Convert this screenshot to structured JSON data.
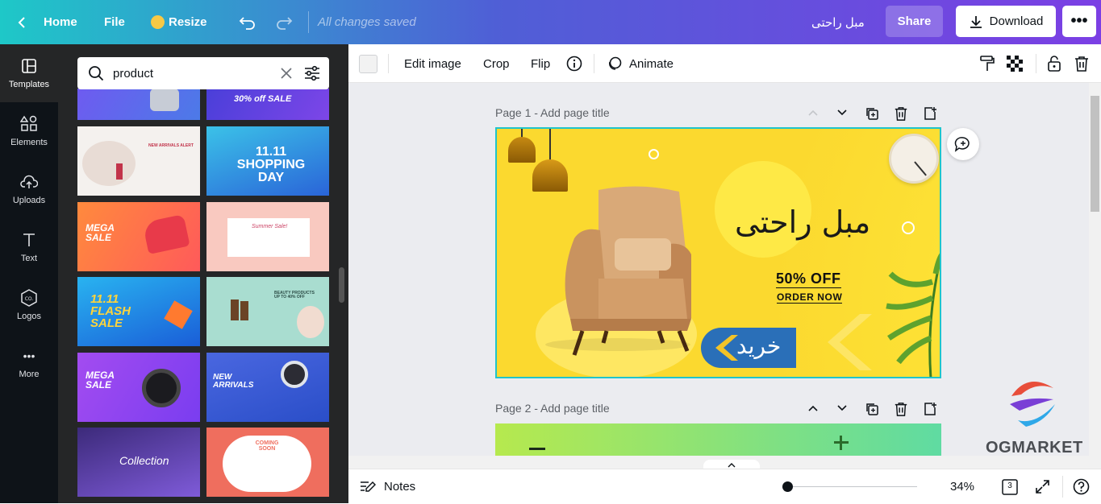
{
  "topbar": {
    "home": "Home",
    "file": "File",
    "resize": "Resize",
    "saved": "All changes saved",
    "doc_title": "مبل راحتی",
    "share": "Share",
    "download": "Download"
  },
  "rail": {
    "items": [
      {
        "label": "Templates",
        "icon": "templates-icon"
      },
      {
        "label": "Elements",
        "icon": "elements-icon"
      },
      {
        "label": "Uploads",
        "icon": "upload-icon"
      },
      {
        "label": "Text",
        "icon": "text-icon"
      },
      {
        "label": "Logos",
        "icon": "logos-icon"
      },
      {
        "label": "More",
        "icon": "more-dots-icon"
      }
    ]
  },
  "search": {
    "value": "product"
  },
  "templates": [
    {
      "text": ""
    },
    {
      "text": "30% off SALE"
    },
    {
      "text": "NEW ARRIVALS ALERT"
    },
    {
      "text": "11.11 SHOPPING DAY"
    },
    {
      "text": "MEGA SALE"
    },
    {
      "text": "Summer Sale!"
    },
    {
      "text": "11.11 FLASH SALE"
    },
    {
      "text": "BEAUTY PRODUCTS UP TO 40% OFF"
    },
    {
      "text": "MEGA SALE"
    },
    {
      "text": "NEW ARRIVALS"
    },
    {
      "text": "Collection"
    },
    {
      "text": "COMING SOON"
    }
  ],
  "toolbar": {
    "edit_image": "Edit image",
    "crop": "Crop",
    "flip": "Flip",
    "animate": "Animate"
  },
  "pages": [
    {
      "header": "Page 1",
      "title_placeholder": "Add page title"
    },
    {
      "header": "Page 2",
      "title_placeholder": "Add page title"
    }
  ],
  "design": {
    "headline": "مبل راحتی",
    "offer": "50% OFF",
    "cta": "ORDER NOW",
    "buy_button": "خرید"
  },
  "watermark": {
    "brand": "OGMARKET"
  },
  "bottombar": {
    "notes": "Notes",
    "zoom": "34%",
    "zoom_fraction": 0.0,
    "page_count": "3"
  },
  "colors": {
    "accent": "#20c4cb",
    "design_bg": "#fbd92f",
    "button_blue": "#2a6fb8"
  }
}
